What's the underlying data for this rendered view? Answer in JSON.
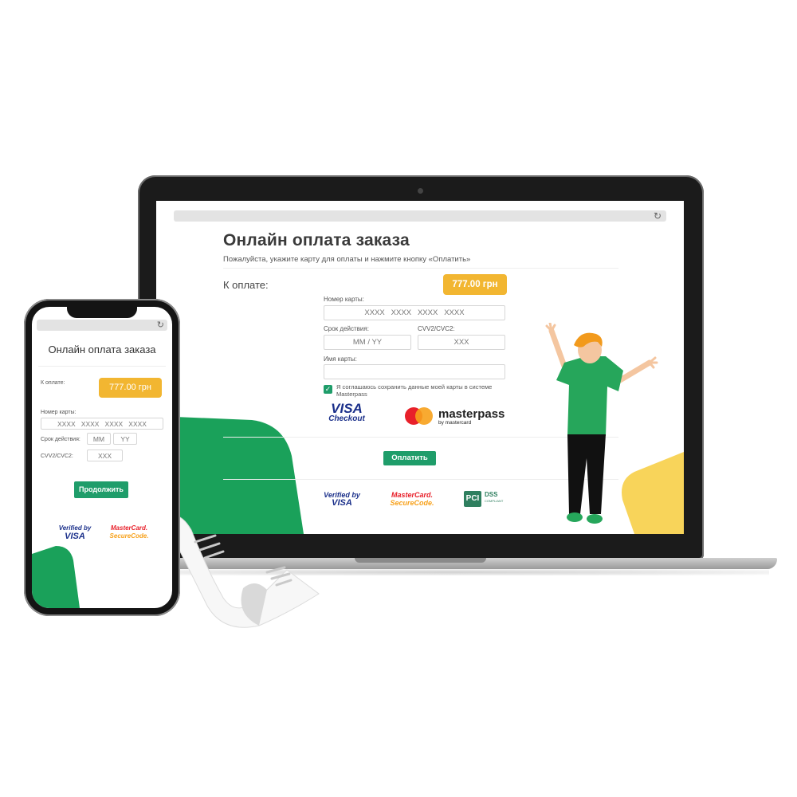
{
  "colors": {
    "accent_green": "#1f9d6a",
    "amount_yellow": "#f2b631",
    "deco_green": "#1aa15a",
    "deco_yellow": "#f8d45a",
    "visa_blue": "#1a2f8a",
    "mastercard_red": "#e8202a",
    "mastercard_orange": "#f7a11b"
  },
  "icons": {
    "reload": "reload-icon",
    "check": "checkmark-icon"
  },
  "laptop": {
    "title": "Онлайн оплата заказа",
    "subtitle": "Пожалуйста, укажите карту для оплаты и нажмите кнопку «Оплатить»",
    "to_pay_label": "К оплате:",
    "amount": "777.00 грн",
    "card_number": {
      "label": "Номер карты:",
      "placeholder": "XXXX   XXXX   XXXX   XXXX"
    },
    "expiry": {
      "label": "Срок действия:",
      "placeholder": "MM / YY"
    },
    "cvv": {
      "label": "CVV2/CVC2:",
      "placeholder": "XXX"
    },
    "card_name": {
      "label": "Имя карты:",
      "placeholder": ""
    },
    "save_consent": {
      "checked": true,
      "text": "Я соглашаюсь сохранить данные моей карты в системе Masterpass"
    },
    "visa_checkout": {
      "line1": "VISA",
      "line2": "Checkout"
    },
    "masterpass": {
      "word": "masterpass",
      "by": "by mastercard"
    },
    "pay_button": "Оплатить",
    "badges": {
      "vbv": {
        "line1": "Verified by",
        "line2": "VISA"
      },
      "msc": {
        "line1": "MasterCard.",
        "line2": "SecureCode."
      },
      "pci": {
        "box": "PCI",
        "dss": "DSS",
        "small": "COMPLIANT"
      }
    }
  },
  "phone": {
    "title": "Онлайн оплата заказа",
    "to_pay_label": "К оплате:",
    "amount": "777.00 грн",
    "card_number": {
      "label": "Номер карты:",
      "placeholder": "XXXX   XXXX   XXXX   XXXX"
    },
    "expiry": {
      "label": "Срок действия:",
      "month_placeholder": "MM",
      "year_placeholder": "YY"
    },
    "cvv": {
      "label": "CVV2/CVC2:",
      "placeholder": "XXX"
    },
    "continue_button": "Продолжить",
    "badges": {
      "vbv": {
        "line1": "Verified by",
        "line2": "VISA"
      },
      "msc": {
        "line1": "MasterCard.",
        "line2": "SecureCode."
      }
    }
  }
}
